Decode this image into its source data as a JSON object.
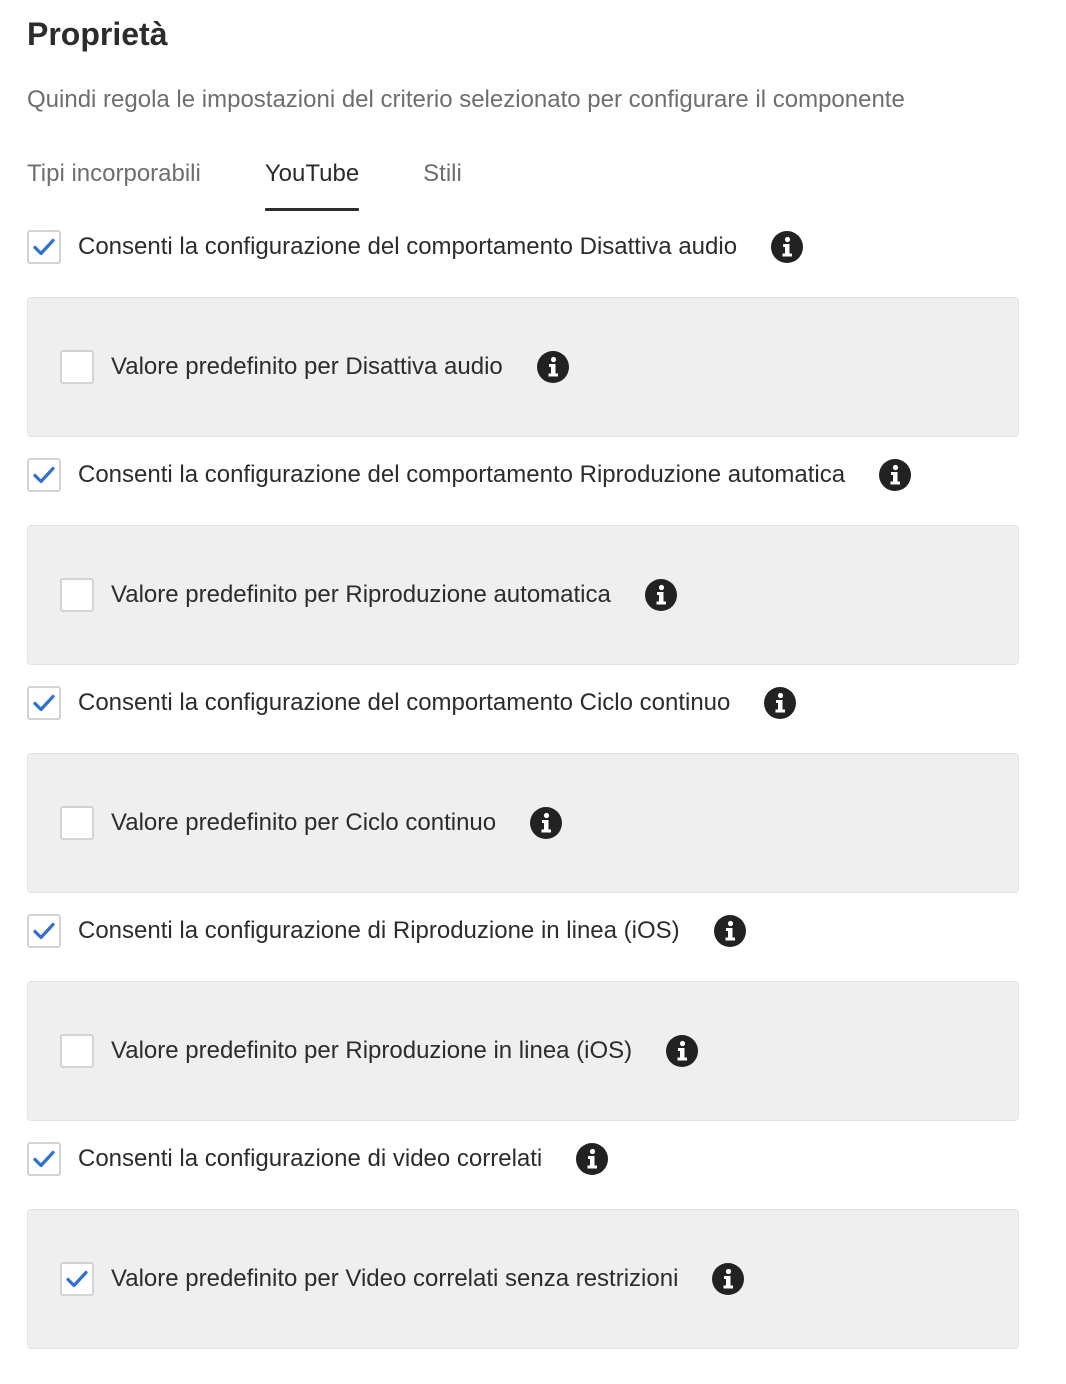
{
  "header": {
    "title": "Proprietà",
    "subtitle": "Quindi regola le impostazioni del criterio selezionato per configurare il componente"
  },
  "tabs": [
    {
      "label": "Tipi incorporabili",
      "active": false
    },
    {
      "label": "YouTube",
      "active": true
    },
    {
      "label": "Stili",
      "active": false
    }
  ],
  "settings": [
    {
      "label": "Consenti la configurazione del comportamento Disattiva audio",
      "checked": true,
      "default_label": "Valore predefinito per Disattiva audio",
      "default_checked": false
    },
    {
      "label": "Consenti la configurazione del comportamento Riproduzione automatica",
      "checked": true,
      "default_label": "Valore predefinito per Riproduzione automatica",
      "default_checked": false
    },
    {
      "label": "Consenti la configurazione del comportamento Ciclo continuo",
      "checked": true,
      "default_label": "Valore predefinito per Ciclo continuo",
      "default_checked": false
    },
    {
      "label": "Consenti la configurazione di Riproduzione in linea (iOS)",
      "checked": true,
      "default_label": "Valore predefinito per Riproduzione in linea (iOS)",
      "default_checked": false
    },
    {
      "label": "Consenti la configurazione di video correlati",
      "checked": true,
      "default_label": "Valore predefinito per Video correlati senza restrizioni",
      "default_checked": true
    }
  ],
  "colors": {
    "checkmark": "#2f6fd6",
    "panel_background": "#efefef",
    "info_icon": "#222222"
  },
  "icons": {
    "checkbox_checked": "checkmark-icon",
    "info": "info-icon"
  }
}
